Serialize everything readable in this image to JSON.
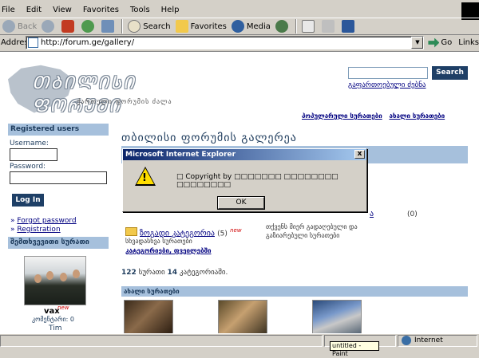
{
  "menu": [
    "File",
    "Edit",
    "View",
    "Favorites",
    "Tools",
    "Help"
  ],
  "toolbar": {
    "back": "Back",
    "search": "Search",
    "favorites": "Favorites",
    "media": "Media"
  },
  "address": {
    "label": "Address",
    "url": "http://forum.ge/gallery/",
    "go": "Go",
    "links": "Links"
  },
  "site": {
    "logo_title": "ᲗᲑᲘᲚᲘᲡᲘ ᲤᲝᲠᲣᲛᲘ",
    "logo_sub": "ქართული ფორუმის ძალა",
    "search_button": "Search",
    "advanced_search": "გაფართოებული ძებნა",
    "top_links": [
      "პოპულარული სურათები",
      "ახალი სურათები"
    ]
  },
  "sidebar": {
    "registered_heading": "Registered users",
    "username_label": "Username:",
    "password_label": "Password:",
    "login_button": "Log In",
    "forgot_password": "Forgot password",
    "registration": "Registration",
    "random_heading": "შემთხვევითი სურათი",
    "user_name": "vax",
    "new_badge": "new",
    "comments_label": "კომენტარი: 0",
    "user_tim": "Tim"
  },
  "main": {
    "title": "თბილისი ფორუმის გალერეა",
    "partial_link": "ა",
    "partial_count": "(0)",
    "category_name": "ზოგადი კატეგორია",
    "category_count": "(5)",
    "category_new": "new",
    "category_sub": "სხვადასხვა სურათები",
    "category_link2": "კატეგორიები, ფვეილებში",
    "category_desc_1": "თქვენს მიერ გადაღებული და",
    "category_desc_2": "გაზიარებული სურათები",
    "stats_images": "122",
    "stats_text_1": " სურათი ",
    "stats_categories": "14",
    "stats_text_2": " კატეგორიაში.",
    "new_images_heading": "ახალი სურათები"
  },
  "dialog": {
    "title": "Microsoft Internet Explorer",
    "close": "x",
    "message": "□ Copyright by □□□□□□□ □□□□□□□□ □□□□□□□□",
    "ok": "OK"
  },
  "status": {
    "zone": "Internet",
    "tooltip": "untitled - Paint"
  },
  "icons": {
    "back": "back-arrow-icon",
    "forward": "forward-arrow-icon",
    "stop": "stop-icon",
    "refresh": "refresh-icon",
    "home": "home-icon",
    "warning": "warning-icon"
  },
  "colors": {
    "accent_bar": "#a6c0dc",
    "button_dark": "#1e3f66",
    "link": "#000080",
    "title_bar": "#0a246a"
  }
}
